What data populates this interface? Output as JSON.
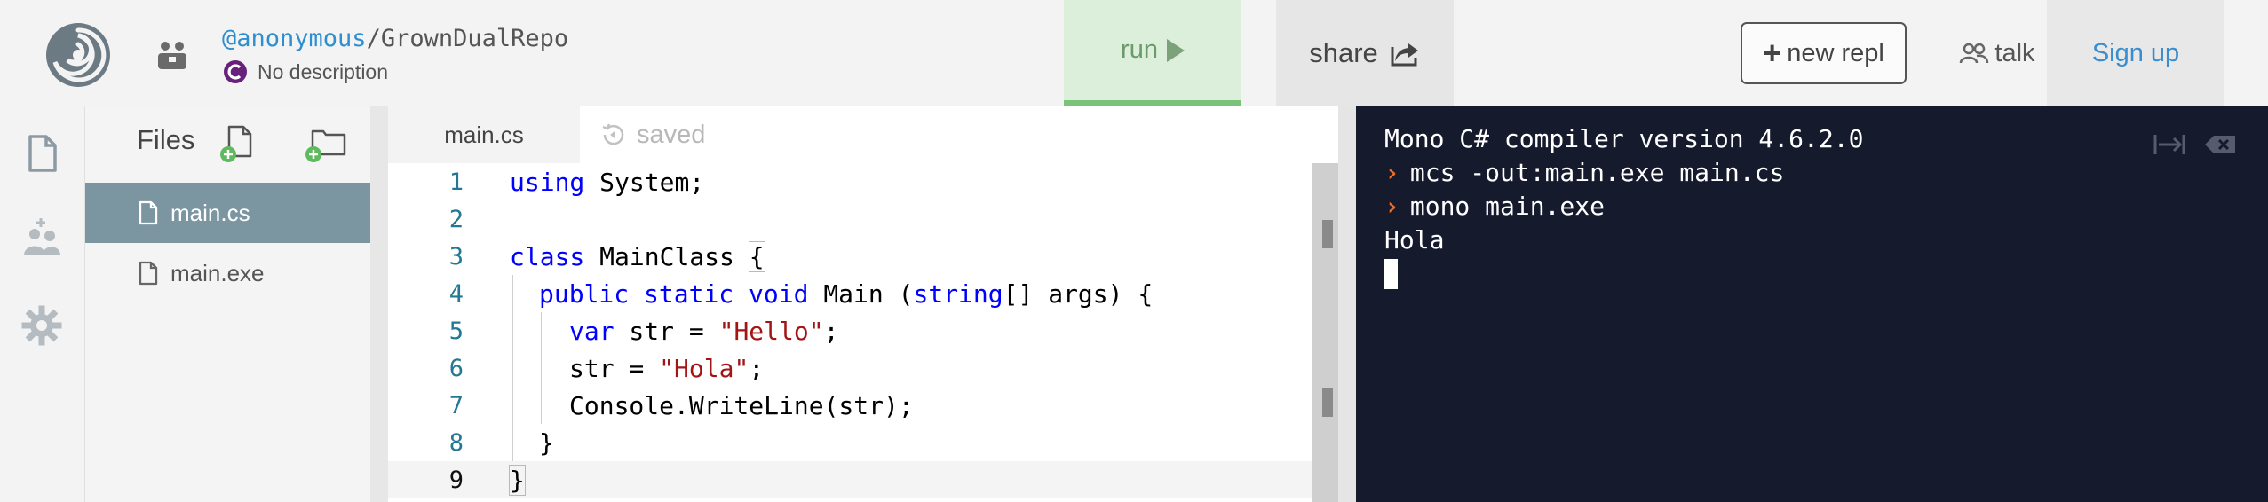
{
  "header": {
    "owner_user": "@anonymous",
    "owner_sep": "/",
    "repl_name": "GrownDualRepo",
    "description": "No description",
    "run_label": "run",
    "share_label": "share",
    "new_repl_label": "new repl",
    "talk_label": "talk",
    "signup_label": "Sign up"
  },
  "files": {
    "title": "Files",
    "items": [
      {
        "name": "main.cs",
        "active": true
      },
      {
        "name": "main.exe",
        "active": false
      }
    ]
  },
  "editor": {
    "tab_label": "main.cs",
    "saved_label": "saved",
    "line_numbers": [
      "1",
      "2",
      "3",
      "4",
      "5",
      "6",
      "7",
      "8",
      "9"
    ],
    "code": {
      "l1_kw": "using",
      "l1_rest": " System;",
      "l3_kw": "class",
      "l3_name": " MainClass ",
      "l3_brace": "{",
      "l4_public": "public",
      "l4_static": "static",
      "l4_void": "void",
      "l4_main": " Main (",
      "l4_string": "string",
      "l4_rest": "[] args) {",
      "l5_var": "var",
      "l5_mid": " str = ",
      "l5_str": "\"Hello\"",
      "l5_end": ";",
      "l6_mid": "str = ",
      "l6_str": "\"Hola\"",
      "l6_end": ";",
      "l7": "Console.WriteLine(str);",
      "l8": "}",
      "l9": "}"
    }
  },
  "console": {
    "lines": [
      "Mono C# compiler version 4.6.2.0",
      "mcs -out:main.exe main.cs",
      "mono main.exe",
      "Hola"
    ],
    "prompt_symbol": "›"
  },
  "colors": {
    "accent_blue": "#2e8fcf",
    "run_green": "#7bc27b",
    "console_bg": "#151a2c",
    "prompt_orange": "#f16c20",
    "active_file_bg": "#7b96a0"
  },
  "icons": {
    "logo": "repl-logo-icon",
    "user": "anonymous-user-icon",
    "lang": "csharp-icon",
    "run": "play-icon",
    "share": "share-icon",
    "new_repl": "plus-icon",
    "talk": "people-icon",
    "rail": [
      "files-icon",
      "invite-icon",
      "settings-icon"
    ],
    "file": "file-icon",
    "saved": "history-icon",
    "console_tools": [
      "exit-icon",
      "clear-icon"
    ]
  }
}
